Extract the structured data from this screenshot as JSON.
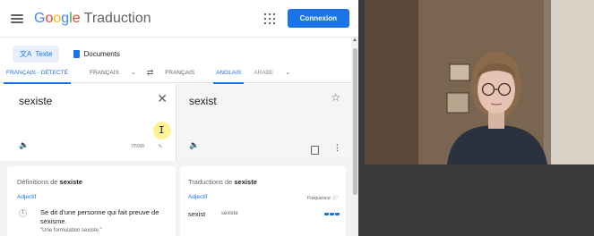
{
  "header": {
    "logo_parts": [
      "G",
      "o",
      "o",
      "g",
      "l",
      "e"
    ],
    "product": "Traduction",
    "signin_label": "Connexion"
  },
  "modes": [
    {
      "label": "Texte",
      "icon": "translate-icon",
      "active": true
    },
    {
      "label": "Documents",
      "icon": "document-icon",
      "active": false
    }
  ],
  "langbar": {
    "source_langs": [
      "FRANÇAIS - DÉTECTÉ",
      "FRANÇAIS"
    ],
    "target_langs": [
      "FRANÇAIS",
      "ANGLAIS",
      "ARABE"
    ],
    "swap_icon": "swap-icon"
  },
  "source": {
    "text": "sexiste",
    "char_count": "7/5000"
  },
  "target": {
    "text": "sexist"
  },
  "definitions": {
    "title_prefix": "Définitions de ",
    "term": "sexiste",
    "part_of_speech": "Adjectif",
    "number": "1",
    "definition": "Se dit d'une personne qui fait preuve de sexisme.",
    "example": "\"Une formulation sexiste.\""
  },
  "translations": {
    "title_prefix": "Traductions de ",
    "term": "sexiste",
    "part_of_speech": "Adjectif",
    "frequency_label": "Fréquence",
    "word": "sexist",
    "back_translation": "sexiste",
    "frequency_level": 3
  },
  "colors": {
    "accent": "#1a73e8",
    "cursor_highlight": "#fff07a"
  }
}
